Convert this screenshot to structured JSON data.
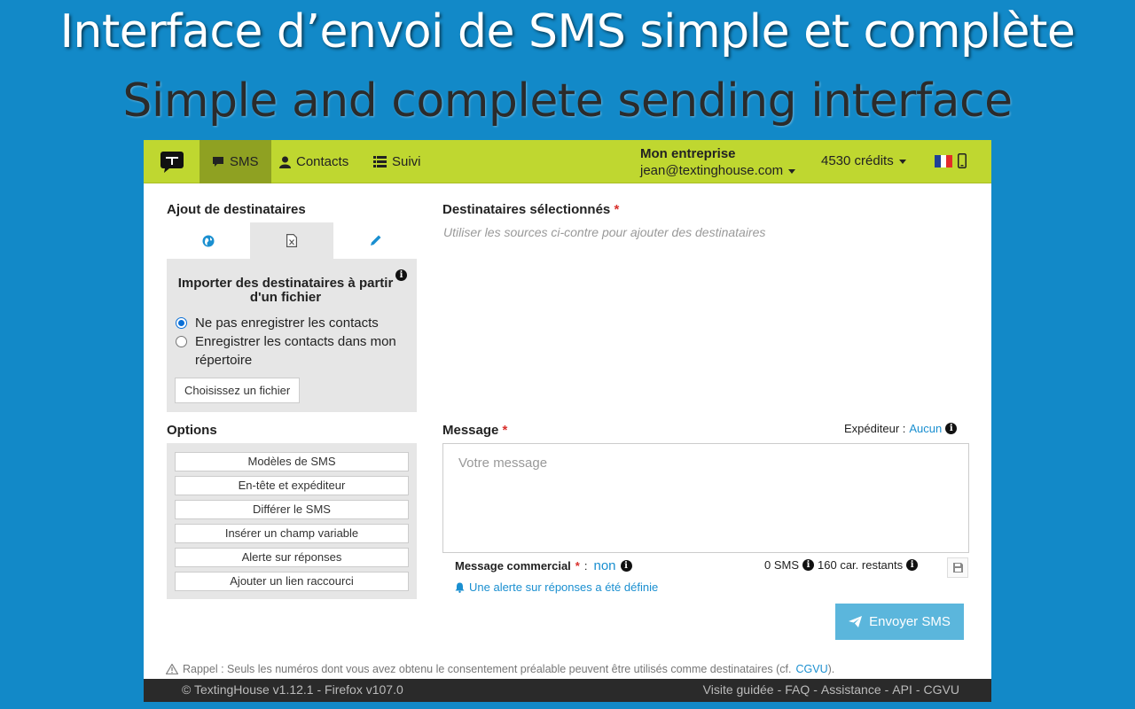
{
  "banner": {
    "title_fr": "Interface d’envoi de SMS simple et complète",
    "title_en": "Simple and complete sending interface"
  },
  "navbar": {
    "tabs": [
      {
        "label": "SMS",
        "icon": "comment-icon",
        "active": true
      },
      {
        "label": "Contacts",
        "icon": "user-icon",
        "active": false
      },
      {
        "label": "Suivi",
        "icon": "list-icon",
        "active": false
      }
    ],
    "account": {
      "company": "Mon entreprise",
      "email": "jean@textinghouse.com"
    },
    "credits": "4530 crédits",
    "colors": {
      "bar": "#bfd730",
      "active_tab": "#8fa122"
    }
  },
  "left": {
    "recipients_title": "Ajout de destinataires",
    "source_tabs": [
      {
        "icon": "globe-icon",
        "active": false
      },
      {
        "icon": "excel-file-icon",
        "active": true
      },
      {
        "icon": "pencil-icon",
        "active": false
      }
    ],
    "import": {
      "title": "Importer des destinataires à partir d'un fichier",
      "options": [
        {
          "label": "Ne pas enregistrer les contacts",
          "checked": true
        },
        {
          "label": "Enregistrer les contacts dans mon répertoire",
          "checked": false
        }
      ],
      "file_button": "Choisissez un fichier"
    },
    "options_title": "Options",
    "options": [
      "Modèles de SMS",
      "En-tête et expéditeur",
      "Différer le SMS",
      "Insérer un champ variable",
      "Alerte sur réponses",
      "Ajouter un lien raccourci"
    ]
  },
  "right": {
    "selected_title": "Destinataires sélectionnés",
    "required_mark": "*",
    "selected_placeholder": "Utiliser les sources ci-contre pour ajouter des destinataires",
    "message_title": "Message",
    "sender_label": "Expéditeur :",
    "sender_value": "Aucun",
    "message_placeholder": "Votre message",
    "commercial_label": "Message commercial",
    "commercial_colon": ":",
    "commercial_value": "non",
    "sms_count": "0 SMS",
    "chars_remaining": "160 car. restants",
    "alert_text": "Une alerte sur réponses a été définie",
    "send_button": "Envoyer SMS"
  },
  "reminder": {
    "text": "Rappel : Seuls les numéros dont vous avez obtenu le consentement préalable peuvent être utilisés comme destinataires (cf.",
    "link": "CGVU",
    "end": ")."
  },
  "footer": {
    "left": "© TextingHouse v1.12.1 - Firefox v107.0",
    "links": [
      "Visite guidée",
      "FAQ",
      "Assistance",
      "API",
      "CGVU"
    ],
    "separator": "-"
  }
}
